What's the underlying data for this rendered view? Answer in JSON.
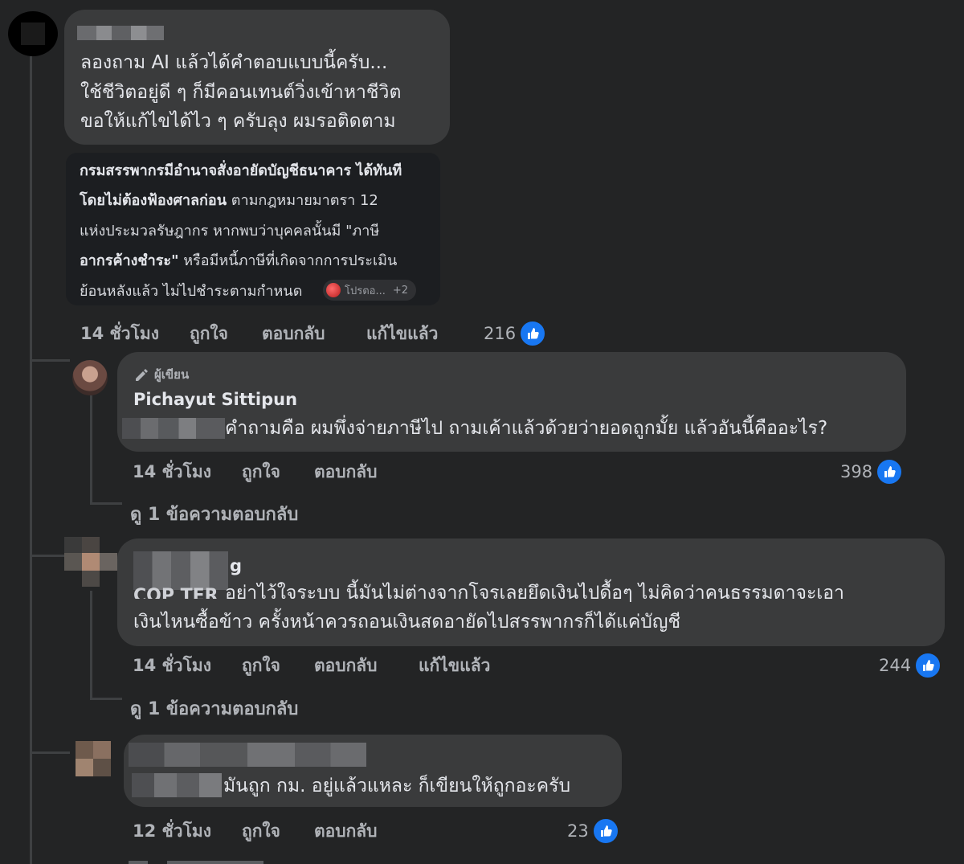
{
  "comment1": {
    "author": "",
    "lines": [
      "ลองถาม AI แล้วได้คำตอบแบบนี้ครับ...",
      "ใช้ชีวิตอยู่ดี ๆ ก็มีคอนเทนต์วิ่งเข้าหาชีวิต",
      "ขอให้แก้ไขได้ไว ๆ ครับลุง ผมรอติดตาม"
    ],
    "ai_card": {
      "lines": [
        {
          "bold": "กรมสรรพากรมีอำนาจสั่งอายัดบัญชีธนาคาร ได้ทันที",
          "normal": ""
        },
        {
          "bold": "โดยไม่ต้องฟ้องศาลก่อน",
          "normal": " ตามกฎหมายมาตรา 12"
        },
        {
          "bold": "",
          "normal": "แห่งประมวลรัษฎากร หากพบว่าบุคคลนั้นมี \"ภาษี"
        },
        {
          "bold": "อากรค้างชำระ\"",
          "normal": " หรือมีหนี้ภาษีที่เกิดจากการประเมิน"
        },
        {
          "bold": "",
          "normal": "ย้อนหลังแล้ว ไม่ไปชำระตามกำหนด"
        }
      ],
      "source_label": "โปรตอ...",
      "source_more": "+2"
    },
    "time": "14 ชั่วโมง",
    "like": "ถูกใจ",
    "reply": "ตอบกลับ",
    "edited": "แก้ไขแล้ว",
    "reaction_count": "216"
  },
  "reply1": {
    "badge": "ผู้เขียน",
    "author": "Pichayut Sittipun",
    "text": "คำถามคือ ผมพึ่งจ่ายภาษีไป ถามเค้าแล้วด้วยว่ายอดถูกมั้ย แล้วอันนี้คืออะไร?",
    "time": "14 ชั่วโมง",
    "like": "ถูกใจ",
    "reply": "ตอบกลับ",
    "reaction_count": "398",
    "view_replies": "ดู 1 ข้อความตอบกลับ"
  },
  "reply2": {
    "author_visible": "g",
    "partial_tag": "COP TER",
    "lines": [
      "อย่าไว้ใจระบบ นี้มันไม่ต่างจากโจรเลยยึดเงินไปดื้อๆ ไม่คิดว่าคนธรรมดาจะเอา",
      "เงินไหนซื้อข้าว ครั้งหน้าควรถอนเงินสดอายัดไปสรรพากรก็ได้แค่บัญชี"
    ],
    "time": "14 ชั่วโมง",
    "like": "ถูกใจ",
    "reply": "ตอบกลับ",
    "edited": "แก้ไขแล้ว",
    "reaction_count": "244",
    "view_replies": "ดู 1 ข้อความตอบกลับ"
  },
  "reply3": {
    "text": "มันถูก กม. อยู่แล้วแหละ ก็เขียนให้ถูกอะครับ",
    "time": "12 ชั่วโมง",
    "like": "ถูกใจ",
    "reply": "ตอบกลับ",
    "reaction_count": "23"
  },
  "colors": {
    "background": "#232425",
    "bubble": "#3a3b3c",
    "like_blue": "#1877f2",
    "meta_text": "#b0b3b8"
  }
}
